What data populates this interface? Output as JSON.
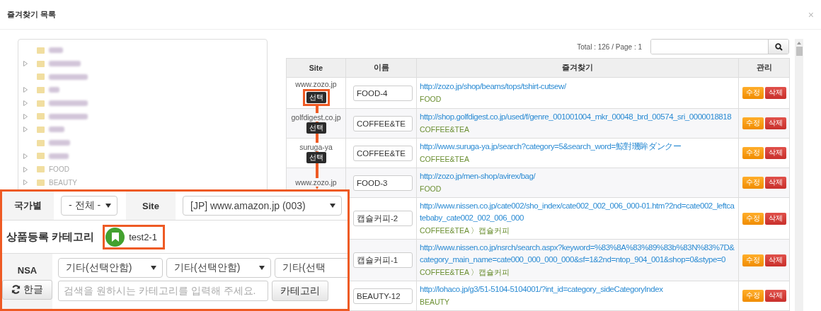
{
  "dialog": {
    "title": "즐겨찾기 목록",
    "close": "×"
  },
  "tree": {
    "items": [
      {
        "kind": "blurred",
        "expandable": false
      },
      {
        "kind": "blurred",
        "expandable": true
      },
      {
        "kind": "blurred",
        "expandable": false
      },
      {
        "kind": "blurred",
        "expandable": true
      },
      {
        "kind": "blurred",
        "expandable": true
      },
      {
        "kind": "blurred",
        "expandable": true
      },
      {
        "kind": "blurred",
        "expandable": true
      },
      {
        "kind": "blurred",
        "expandable": false
      },
      {
        "kind": "blurred",
        "expandable": true
      },
      {
        "kind": "text",
        "label": "FOOD",
        "expandable": true
      },
      {
        "kind": "text",
        "label": "BEAUTY",
        "expandable": true
      }
    ]
  },
  "summary": "Total : 126 / Page : 1",
  "table": {
    "columns": [
      "Site",
      "이름",
      "즐겨찾기",
      "관리"
    ],
    "rows": [
      {
        "site": "www.zozo.jp",
        "select": "선택",
        "annotated": true,
        "name": "FOOD-4",
        "url": "http://zozo.jp/shop/beams/tops/tshirt-cutsew/",
        "category": "FOOD",
        "edit": "수정",
        "delete": "삭제"
      },
      {
        "site": "golfdigest.co.jp",
        "select": "선택",
        "annotated": false,
        "name": "COFFEE&TE",
        "url": "http://shop.golfdigest.co.jp/used/f/genre_001001004_mkr_00048_brd_00574_sri_0000018818",
        "category": "COFFEE&TEA",
        "edit": "수정",
        "delete": "삭제"
      },
      {
        "site": "suruga-ya",
        "select": "선택",
        "annotated": false,
        "name": "COFFEE&TE",
        "url": "http://www.suruga-ya.jp/search?category=5&search_word=鯨對璣眸ダンクー",
        "category": "COFFEE&TEA",
        "edit": "수정",
        "delete": "삭제"
      },
      {
        "site": "www.zozo.jp",
        "annotated": false,
        "name": "FOOD-3",
        "url": "http://zozo.jp/men-shop/avirex/bag/",
        "category": "FOOD",
        "edit": "수정",
        "delete": "삭제"
      },
      {
        "annotated": false,
        "name": "캡슐커피-2",
        "url": "http://www.nissen.co.jp/cate002/sho_index/cate002_002_006_000-01.htm?2nd=cate002_leftcatebaby_cate002_002_006_000",
        "category": "COFFEE&TEA 〉캡슐커피",
        "edit": "수정",
        "delete": "삭제"
      },
      {
        "annotated": false,
        "name": "캡슐커피-1",
        "url": "http://www.nissen.co.jp/nsrch/search.aspx?keyword=%83%8A%83%89%83b%83N%83%7D&category_main_name=cate000_000_000_000&sf=1&2nd=ntop_904_001&shop=0&stype=0",
        "category": "COFFEE&TEA 〉캡슐커피",
        "edit": "수정",
        "delete": "삭제"
      },
      {
        "annotated": false,
        "name": "BEAUTY-12",
        "url": "http://lohaco.jp/g3/51-5104-5104001/?int_id=category_sideCategoryIndex",
        "category": "BEAUTY",
        "edit": "수정",
        "delete": "삭제"
      }
    ]
  },
  "category_panel": {
    "country": {
      "label": "국가별",
      "value": "- 전체 -"
    },
    "site": {
      "label": "Site",
      "value": "[JP] www.amazon.jp (003)"
    },
    "category": {
      "label": "상품등록 카테고리",
      "tag": "test2-1",
      "annotated": true
    },
    "nsa": {
      "label": "NSA",
      "button": "한글",
      "selects": [
        "기타(선택안함)",
        "기타(선택안함)",
        "기타(선택"
      ],
      "search_placeholder": "검색을 원하시는 카테고리를 입력해 주세요.",
      "search_button": "카테고리"
    }
  }
}
